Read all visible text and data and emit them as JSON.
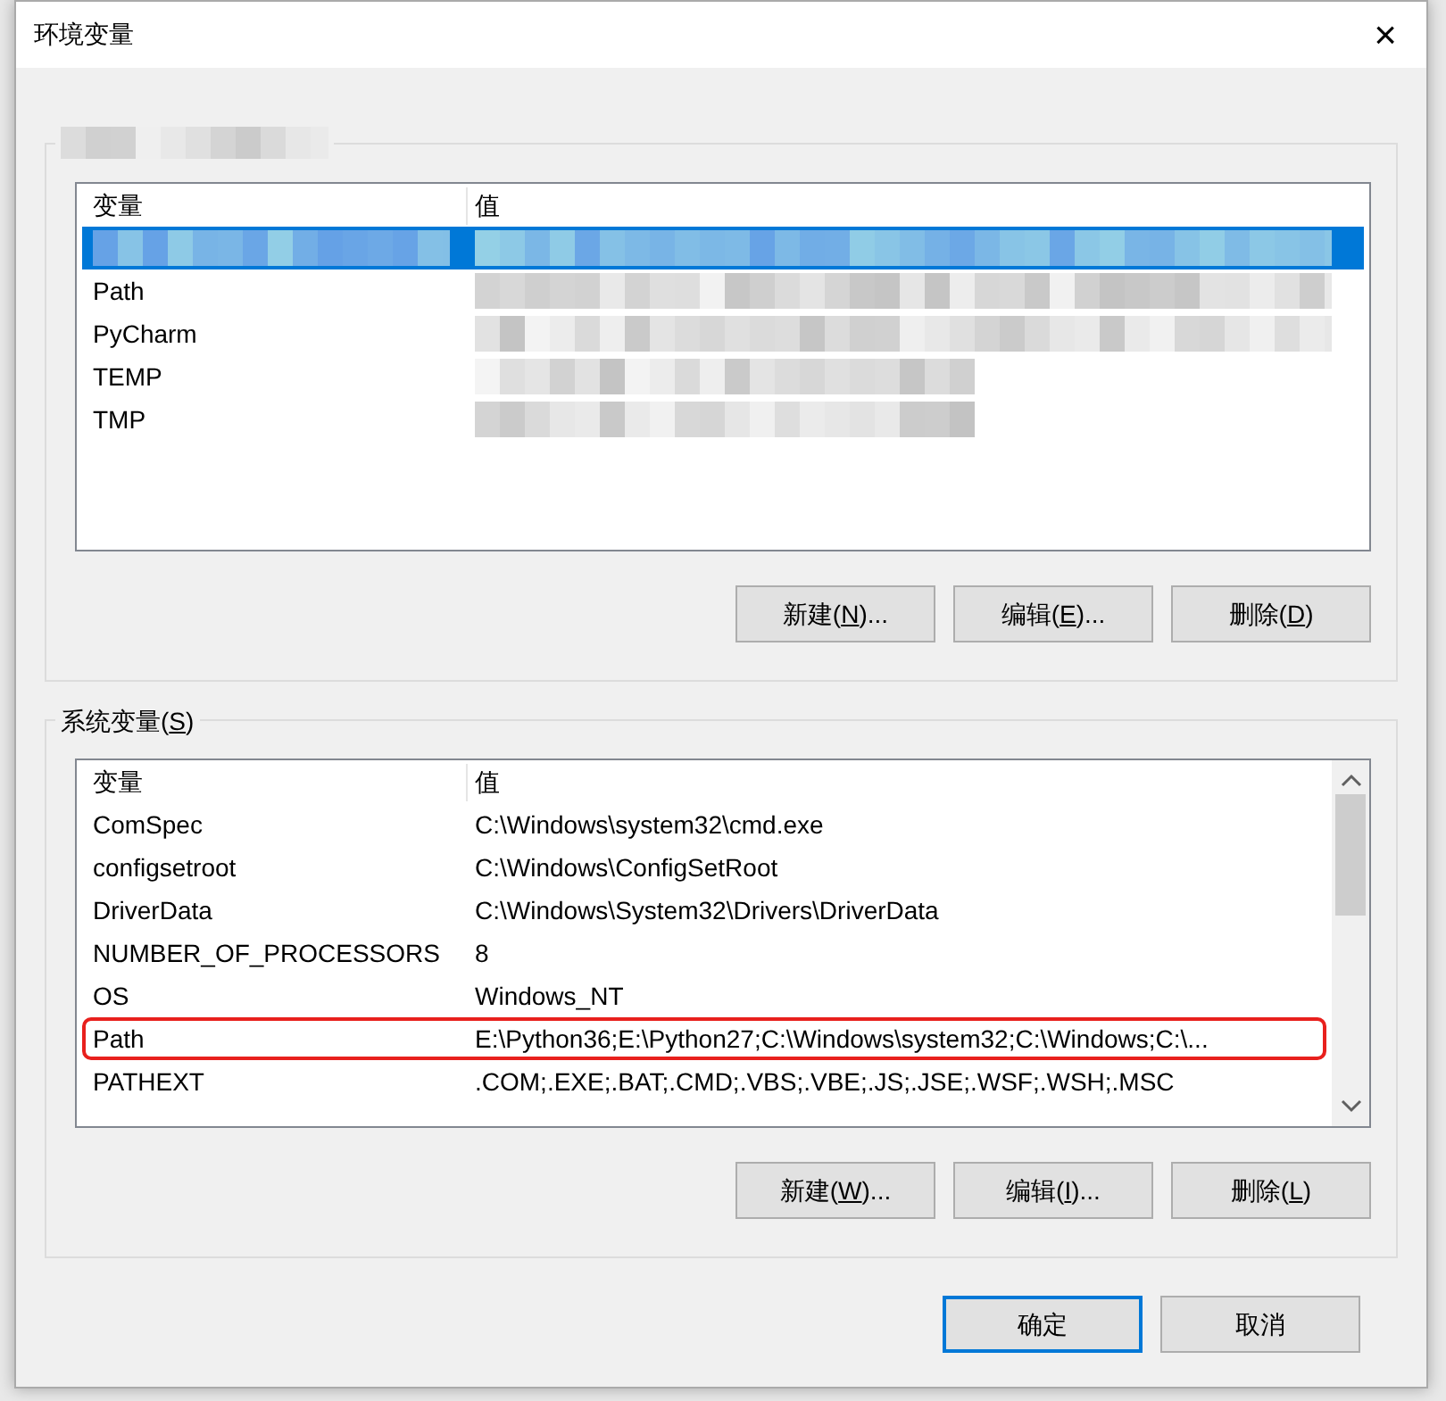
{
  "window": {
    "title": "环境变量",
    "close": "×"
  },
  "user_variables": {
    "label_redacted": true,
    "columns": [
      "变量",
      "值"
    ],
    "rows": [
      {
        "selected": true,
        "value_redacted": true
      },
      {
        "name": "Path",
        "selected": false,
        "value_redacted": true
      },
      {
        "name": "PyCharm",
        "selected": false,
        "value_redacted": true
      },
      {
        "name": "TEMP",
        "selected": false,
        "value_redacted": true
      },
      {
        "name": "TMP",
        "selected": false,
        "value_redacted": true
      }
    ],
    "buttons": [
      {
        "before": "新建(",
        "mnemonic": "N",
        "after": ")..."
      },
      {
        "before": "编辑(",
        "mnemonic": "E",
        "after": ")..."
      },
      {
        "before": "删除(",
        "mnemonic": "D",
        "after": ")"
      }
    ]
  },
  "system_variables": {
    "label": {
      "before": "系统变量(",
      "mnemonic": "S",
      "after": ")"
    },
    "columns": [
      "变量",
      "值"
    ],
    "rows": [
      {
        "name": "ComSpec",
        "value": "C:\\Windows\\system32\\cmd.exe",
        "selected": false,
        "highlighted": false
      },
      {
        "name": "configsetroot",
        "value": "C:\\Windows\\ConfigSetRoot",
        "selected": false,
        "highlighted": false
      },
      {
        "name": "DriverData",
        "value": "C:\\Windows\\System32\\Drivers\\DriverData",
        "selected": false,
        "highlighted": false
      },
      {
        "name": "NUMBER_OF_PROCESSORS",
        "value": "8",
        "selected": false,
        "highlighted": false
      },
      {
        "name": "OS",
        "value": "Windows_NT",
        "selected": false,
        "highlighted": false
      },
      {
        "name": "Path",
        "value": "E:\\Python36;E:\\Python27;C:\\Windows\\system32;C:\\Windows;C:\\...",
        "selected": false,
        "highlighted": true
      },
      {
        "name": "PATHEXT",
        "value": ".COM;.EXE;.BAT;.CMD;.VBS;.VBE;.JS;.JSE;.WSF;.WSH;.MSC",
        "selected": false,
        "highlighted": false
      }
    ],
    "buttons": [
      {
        "before": "新建(",
        "mnemonic": "W",
        "after": ")..."
      },
      {
        "before": "编辑(",
        "mnemonic": "I",
        "after": ")..."
      },
      {
        "before": "删除(",
        "mnemonic": "L",
        "after": ")"
      }
    ]
  },
  "footer_buttons": [
    {
      "label": "确定",
      "default": true
    },
    {
      "label": "取消",
      "default": false
    }
  ]
}
